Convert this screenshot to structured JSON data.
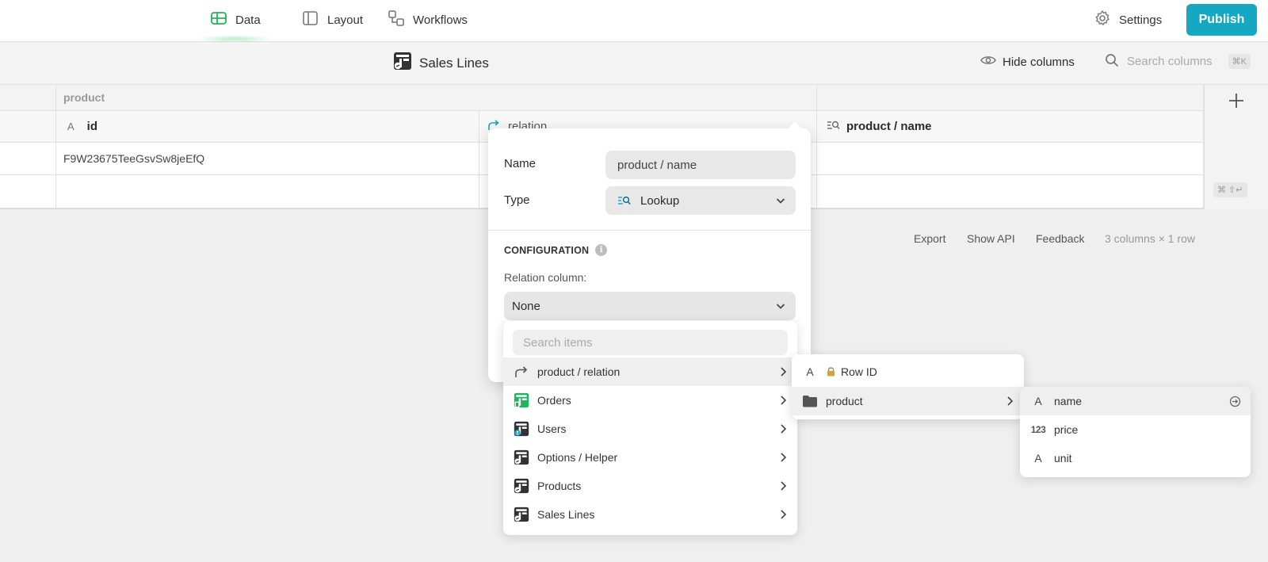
{
  "nav": {
    "tabs": [
      {
        "label": "Data",
        "icon": "grid-icon",
        "active": true
      },
      {
        "label": "Layout",
        "icon": "layout-icon"
      },
      {
        "label": "Workflows",
        "icon": "workflow-icon"
      }
    ],
    "settings_label": "Settings",
    "publish_label": "Publish"
  },
  "table": {
    "title": "Sales Lines",
    "hide_columns_label": "Hide columns",
    "search_placeholder": "Search columns",
    "search_shortcut": "⌘K"
  },
  "grid": {
    "group_header": "product",
    "columns": [
      {
        "label": "id",
        "icon": "text-icon"
      },
      {
        "label": "relation",
        "icon": "relation-icon"
      },
      {
        "label": "product / name",
        "icon": "lookup-icon"
      }
    ],
    "rows": [
      {
        "id": "F9W23675TeeGsvSw8jeEfQ",
        "relation": "",
        "product_name": ""
      }
    ],
    "new_row_shortcut": "⌘ ⇧↵"
  },
  "footer": {
    "export_label": "Export",
    "show_api_label": "Show API",
    "feedback_label": "Feedback",
    "summary": "3 columns × 1 row"
  },
  "column_editor": {
    "name_label": "Name",
    "name_value": "product / name",
    "type_label": "Type",
    "type_value": "Lookup",
    "config_title": "CONFIGURATION",
    "relation_label": "Relation column:",
    "relation_value": "None"
  },
  "relation_menu": {
    "search_placeholder": "Search items",
    "items": [
      {
        "label": "product / relation",
        "icon": "relation-icon"
      },
      {
        "label": "Orders",
        "icon": "table-green-icon"
      },
      {
        "label": "Users",
        "icon": "table-users-icon"
      },
      {
        "label": "Options / Helper",
        "icon": "table-icon"
      },
      {
        "label": "Products",
        "icon": "table-icon"
      },
      {
        "label": "Sales Lines",
        "icon": "table-icon"
      }
    ]
  },
  "submenu": {
    "items": [
      {
        "label": "Row ID",
        "icon": "text-icon",
        "locked": true
      },
      {
        "label": "product",
        "icon": "folder-icon"
      }
    ]
  },
  "field_menu": {
    "items": [
      {
        "label": "name",
        "type_icon": "A"
      },
      {
        "label": "price",
        "type_icon": "123"
      },
      {
        "label": "unit",
        "type_icon": "A"
      }
    ]
  }
}
